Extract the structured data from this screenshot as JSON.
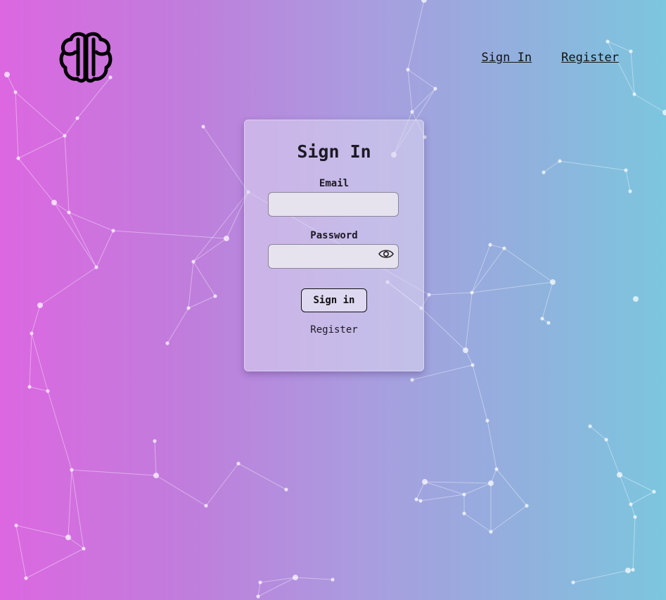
{
  "nav": {
    "sign_in": "Sign In",
    "register": "Register"
  },
  "logo": {
    "icon": "brain-icon"
  },
  "form": {
    "title": "Sign In",
    "email_label": "Email",
    "email_value": "",
    "password_label": "Password",
    "password_value": "",
    "toggle_icon": "eye-icon",
    "submit_label": "Sign in",
    "register_link": "Register"
  },
  "colors": {
    "gradient_left": "#dc67e0",
    "gradient_right": "#7cc6de",
    "card": "#dcd7f0",
    "input": "#e6e3ee",
    "text": "#1c1a24"
  }
}
